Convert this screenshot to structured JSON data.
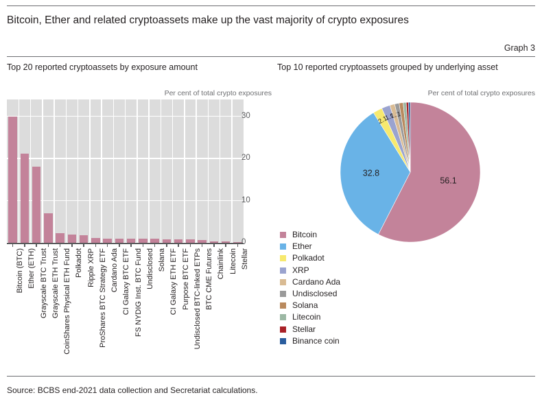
{
  "header": {
    "title": "Bitcoin, Ether and related cryptoassets make up the vast majority of crypto exposures",
    "graph_number": "Graph 3"
  },
  "panels": {
    "left_heading": "Top 20 reported cryptoassets by exposure amount",
    "right_heading": "Top 10 reported cryptoassets grouped by underlying asset",
    "left_unit": "Per cent of total crypto exposures",
    "right_unit": "Per cent of total crypto exposures"
  },
  "footer": {
    "source": "Source: BCBS end-2021 data collection and Secretariat calculations."
  },
  "colors": {
    "bar": "#c3839a",
    "plot_bg": "#dcdcdc",
    "grid": "#ffffff",
    "axis": "#58595b",
    "rule": "#6d6e71",
    "text": "#231f20"
  },
  "chart_data": [
    {
      "type": "bar",
      "title": "Top 20 reported cryptoassets by exposure amount",
      "xlabel": "",
      "ylabel": "Per cent of total crypto exposures",
      "ylim": [
        0,
        34
      ],
      "yticks": [
        0,
        10,
        20,
        30
      ],
      "grid": true,
      "categories": [
        "Bitcoin (BTC)",
        "Ether (ETH)",
        "Grayscale BTC Trust",
        "Grayscale ETH Trust",
        "CoinShares Physical ETH Fund",
        "Polkadot",
        "Ripple XRP",
        "ProShares BTC Strategy ETF",
        "Cardano Ada",
        "CI Galaxy BTC ETF",
        "FS NYDIG Inst. BTC Fund",
        "Undisclosed",
        "Solana",
        "CI Galaxy ETH ETF",
        "Purpose BTC ETF",
        "Undisclosed BTC-linked ETPs",
        "BTC CME Futures",
        "Chainlink",
        "Litecoin",
        "Stellar"
      ],
      "values": [
        29.9,
        21.1,
        18.0,
        7.0,
        2.2,
        1.9,
        1.8,
        1.2,
        0.9,
        0.9,
        0.9,
        0.9,
        0.9,
        0.8,
        0.8,
        0.8,
        0.7,
        0.4,
        0.35,
        0.2
      ]
    },
    {
      "type": "pie",
      "title": "Top 10 reported cryptoassets grouped by underlying asset",
      "unit": "Per cent of total crypto exposures",
      "legend_position": "bottom-left",
      "labels": [
        "Bitcoin",
        "Ether",
        "Polkadot",
        "XRP",
        "Cardano Ada",
        "Undisclosed",
        "Solana",
        "Litecoin",
        "Stellar",
        "Binance coin"
      ],
      "values": [
        56.1,
        32.8,
        2.1,
        1.9,
        1.1,
        1.0,
        0.9,
        0.7,
        0.5,
        0.4
      ],
      "value_labels": [
        "56.1",
        "32.8",
        "2.1",
        "1.9",
        "1.1",
        "1",
        "",
        "",
        "",
        ""
      ],
      "slice_colors": [
        "#c3839a",
        "#69b3e7",
        "#f7e96e",
        "#9aa3cf",
        "#d9bb93",
        "#9a9a9a",
        "#b98a5e",
        "#9cb8a4",
        "#a92127",
        "#2a5d9e"
      ]
    }
  ]
}
